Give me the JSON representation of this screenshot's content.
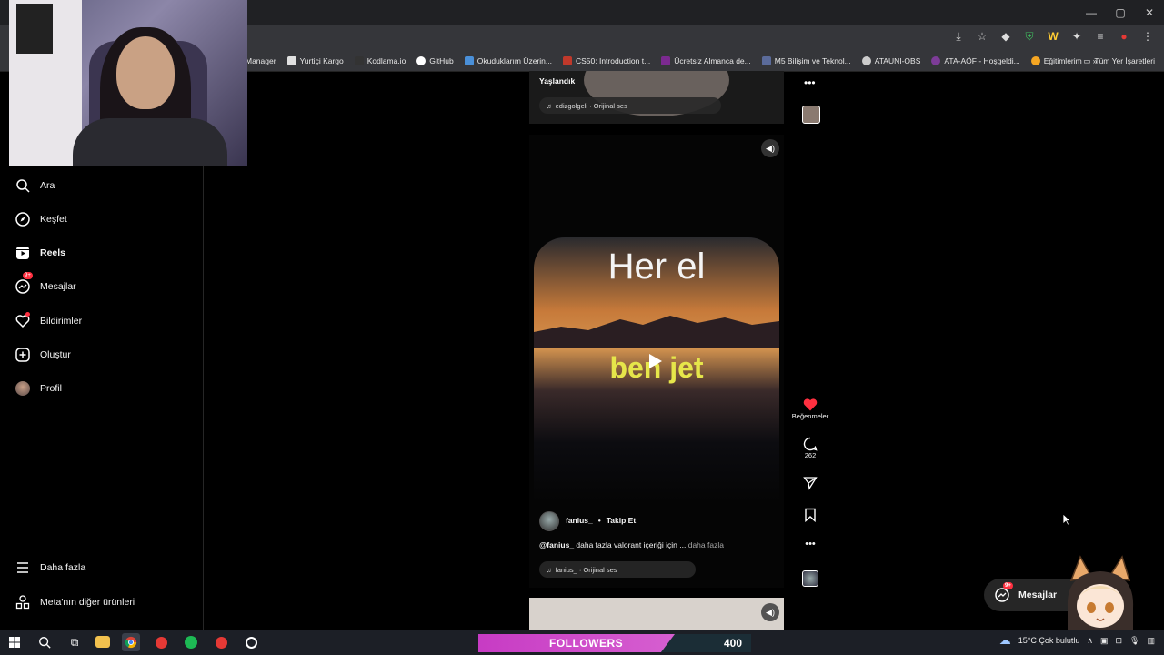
{
  "browser": {
    "window_controls": [
      "—",
      "▢",
      "✕"
    ],
    "bookmarks": [
      {
        "label": "Manager",
        "color": "#2b2b2b"
      },
      {
        "label": "Yurtiçi Kargo",
        "color": "#e0e0e0"
      },
      {
        "label": "Kodlama.io",
        "color": "#333333"
      },
      {
        "label": "GitHub",
        "color": "#ffffff"
      },
      {
        "label": "Okuduklarım Üzerin...",
        "color": "#4a90d9"
      },
      {
        "label": "CS50: Introduction t...",
        "color": "#c0392b"
      },
      {
        "label": "Ücretsiz Almanca de...",
        "color": "#7b2a90"
      },
      {
        "label": "M5 Bilişim ve Teknol...",
        "color": "#5b6b9a"
      },
      {
        "label": "ATAUNI-OBS",
        "color": "#cccccc"
      },
      {
        "label": "ATA-AÖF - Hoşgeldi...",
        "color": "#7d3c98"
      },
      {
        "label": "Eğitimlerim",
        "color": "#f5a623"
      }
    ],
    "bookmarks_overflow": "»",
    "all_bookmarks": "Tüm Yer İşaretleri"
  },
  "sidebar": {
    "items": [
      {
        "label": "Ara",
        "icon": "search-icon"
      },
      {
        "label": "Keşfet",
        "icon": "compass-icon"
      },
      {
        "label": "Reels",
        "icon": "reels-icon"
      },
      {
        "label": "Mesajlar",
        "icon": "messenger-icon",
        "badge": "9+"
      },
      {
        "label": "Bildirimler",
        "icon": "heart-icon"
      },
      {
        "label": "Oluştur",
        "icon": "plus-square-icon"
      },
      {
        "label": "Profil",
        "icon": "avatar"
      }
    ],
    "more": "Daha fazla",
    "meta": "Meta'nın diğer ürünleri"
  },
  "reel_top": {
    "caption": "Yaşlandık",
    "audio": "edizgolgeli · Orijinal ses"
  },
  "reel_main": {
    "overlay_line1": "Her el",
    "overlay_line2": "ben jet",
    "username": "fanius_",
    "separator": "•",
    "follow": "Takip Et",
    "caption_user": "@fanius_",
    "caption_text": " daha fazla valorant içeriği için ...",
    "more": " daha fazla",
    "audio": "fanius_ · Orijinal ses"
  },
  "actions": {
    "likes_label": "Beğenmeler",
    "comments": "262"
  },
  "floating_messages": {
    "label": "Mesajlar",
    "badge": "9+"
  },
  "stream": {
    "followers_label": "FOLLOWERS",
    "followers_count": "400",
    "followers_progress": 0.72
  },
  "taskbar": {
    "weather": "15°C  Çok bulutlu"
  },
  "colors": {
    "like_red": "#ff3040",
    "badge_red": "#ff3040",
    "followers_pink": "#c73bc4"
  }
}
